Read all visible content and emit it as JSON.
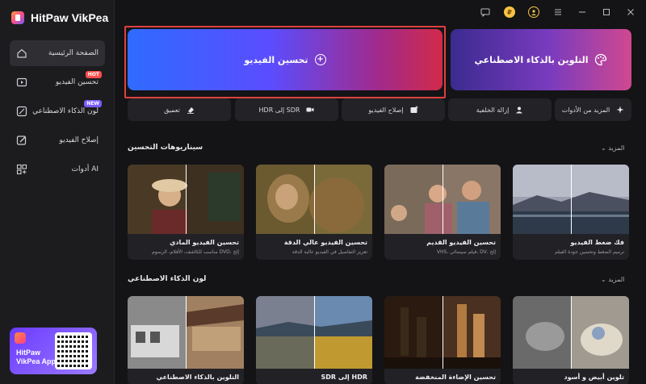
{
  "app": {
    "name": "HitPaw VikPea"
  },
  "sidebar": {
    "items": [
      {
        "label": "الصفحة الرئيسية",
        "icon": "home-icon",
        "badge": ""
      },
      {
        "label": "تحسين الفيديو",
        "icon": "video-enhance-icon",
        "badge": "HOT"
      },
      {
        "label": "لون الذكاء الاصطناعي",
        "icon": "ai-color-icon",
        "badge": "NEW"
      },
      {
        "label": "إصلاح الفيديو",
        "icon": "repair-icon",
        "badge": ""
      },
      {
        "label": "أدوات AI",
        "icon": "ai-tools-icon",
        "badge": ""
      }
    ],
    "app_card": {
      "line1": "HitPaw",
      "line2": "VikPea App"
    }
  },
  "titlebar": {
    "coin": "₽"
  },
  "features": {
    "enhance": {
      "label": "تحسين الفيديو",
      "icon": "plus-circle-icon"
    },
    "colorize": {
      "label": "التلوين بالذكاء الاصطناعي",
      "icon": "palette-icon"
    }
  },
  "tools": [
    {
      "label": "تعميق",
      "icon": "eraser-icon"
    },
    {
      "label": "HDR إلى SDR",
      "icon": "camera-icon"
    },
    {
      "label": "إصلاح الفيديو",
      "icon": "image-plus-icon"
    },
    {
      "label": "إزالة الخلفية",
      "icon": "person-bg-icon"
    },
    {
      "label": "المزيد من الأدوات",
      "icon": "sparkle-icon"
    }
  ],
  "section1": {
    "title": "سيناريوهات التحسين",
    "more": "المزيد",
    "cards": [
      {
        "title": "تحسين الفيديو المادي",
        "desc": "مناسب للكاشف، الأفلام، الرسوم DVD، إلخ"
      },
      {
        "title": "تحسين الفيديو عالي الدقة",
        "desc": "تعزيز التفاصيل في الفيديو عالية الدقة"
      },
      {
        "title": "تحسين الفيديو القديم",
        "desc": "VHS، فيلم سينمائي، DV، إلخ"
      },
      {
        "title": "فك ضغط الفيديو",
        "desc": "ترميم الضغط وتحسين جودة الفيلم"
      }
    ]
  },
  "section2": {
    "title": "لون الذكاء الاصطناعي",
    "more": "المزيد",
    "cards": [
      {
        "title": "التلوين بالذكاء الاصطناعي"
      },
      {
        "title": "SDR إلى HDR"
      },
      {
        "title": "تحسين الإضاءة المنخفضة"
      },
      {
        "title": "تلوين أبيض و أسود"
      }
    ]
  }
}
